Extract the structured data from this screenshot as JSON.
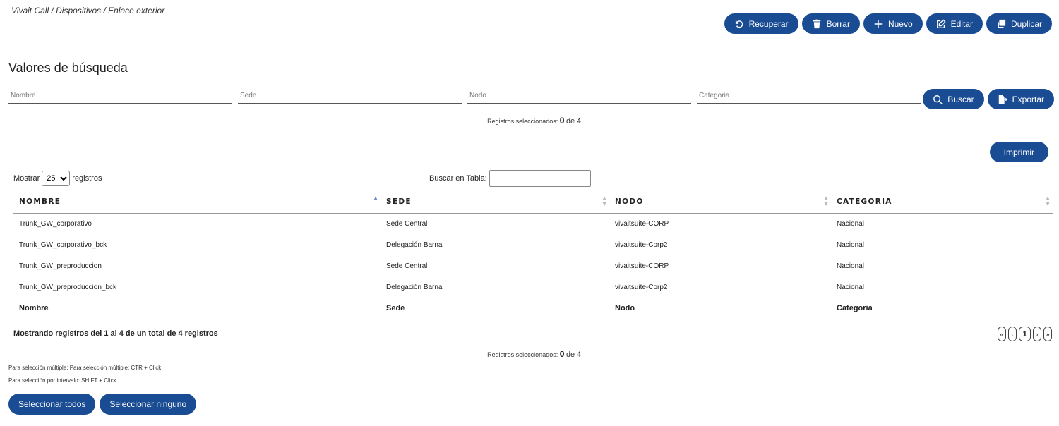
{
  "breadcrumb": "Vivait Call / Dispositivos / Enlace exterior",
  "toolbar": {
    "recuperar": "Recuperar",
    "borrar": "Borrar",
    "nuevo": "Nuevo",
    "editar": "Editar",
    "duplicar": "Duplicar"
  },
  "search": {
    "title": "Valores de búsqueda",
    "nombre_placeholder": "Nombre",
    "sede_placeholder": "Sede",
    "nodo_placeholder": "Nodo",
    "categoria_placeholder": "Categoria",
    "buscar": "Buscar",
    "exportar": "Exportar"
  },
  "selected": {
    "label": "Registros seleccionados:",
    "count": "0",
    "of": "de",
    "total": "4"
  },
  "print_label": "Imprimir",
  "table_controls": {
    "show_label": "Mostrar",
    "show_value": "25",
    "records_label": "registros",
    "search_label": "Buscar en Tabla:"
  },
  "table": {
    "headers": [
      "NOMBRE",
      "SEDE",
      "NODO",
      "CATEGORIA"
    ],
    "rows": [
      [
        "Trunk_GW_corporativo",
        "Sede Central",
        "vivaitsuite-CORP",
        "Nacional"
      ],
      [
        "Trunk_GW_corporativo_bck",
        "Delegación Barna",
        "vivaitsuite-Corp2",
        "Nacional"
      ],
      [
        "Trunk_GW_preproduccion",
        "Sede Central",
        "vivaitsuite-CORP",
        "Nacional"
      ],
      [
        "Trunk_GW_preproduccion_bck",
        "Delegación Barna",
        "vivaitsuite-Corp2",
        "Nacional"
      ]
    ],
    "footers": [
      "Nombre",
      "Sede",
      "Nodo",
      "Categoria"
    ]
  },
  "info": "Mostrando registros del 1 al 4 de un total de 4 registros",
  "pagination": {
    "first": "«",
    "prev": "‹",
    "current": "1",
    "next": "›",
    "last": "»"
  },
  "hints": {
    "multi": "Para selección múltiple: Para selección múltiple: CTR + Click",
    "range": "Para selección por intervalo: SHIFT + Click"
  },
  "bottom": {
    "select_all": "Seleccionar todos",
    "select_none": "Seleccionar ninguno"
  },
  "colors": {
    "primary": "#1a4c94"
  }
}
